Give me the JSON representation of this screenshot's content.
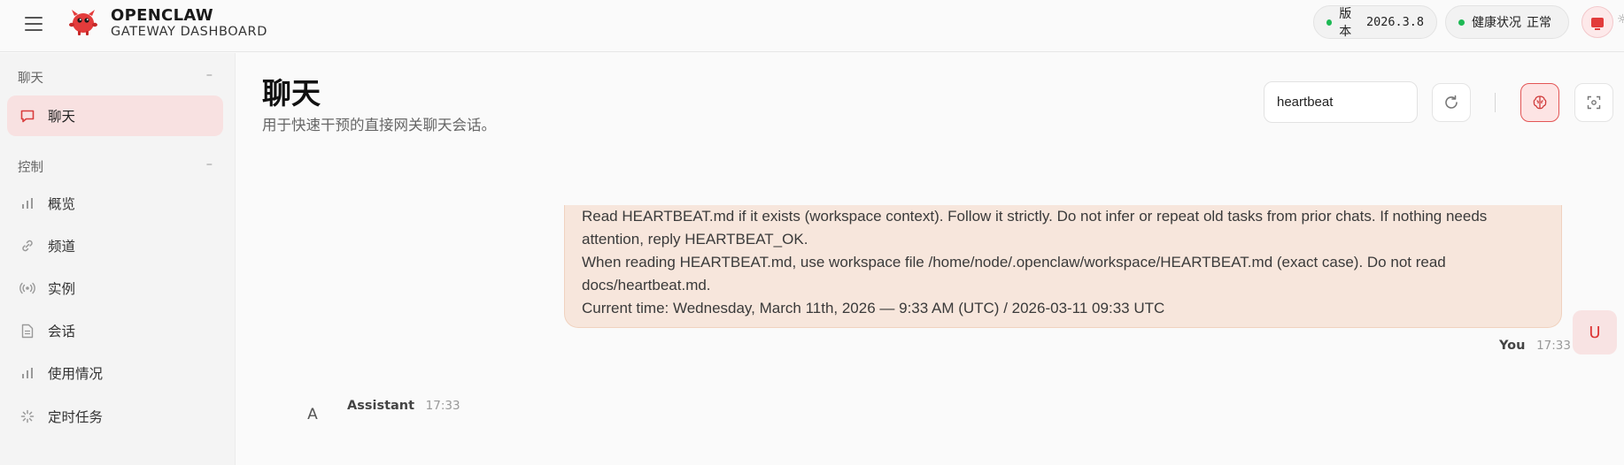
{
  "topbar": {
    "brand_title": "OPENCLAW",
    "brand_subtitle": "GATEWAY DASHBOARD",
    "version_label": "版本",
    "version_value": "2026.3.8",
    "health_label": "健康状况",
    "health_value": "正常",
    "status_color": "#1db954",
    "accent_color": "#e23b3b"
  },
  "sidebar": {
    "sections": [
      {
        "title": "聊天",
        "collapse_symbol": "–",
        "items": [
          {
            "label": "聊天",
            "icon": "chat-bubble-icon",
            "active": true
          }
        ]
      },
      {
        "title": "控制",
        "collapse_symbol": "–",
        "items": [
          {
            "label": "概览",
            "icon": "bar-chart-icon"
          },
          {
            "label": "频道",
            "icon": "link-icon"
          },
          {
            "label": "实例",
            "icon": "broadcast-icon"
          },
          {
            "label": "会话",
            "icon": "document-icon"
          },
          {
            "label": "使用情况",
            "icon": "bar-chart-icon"
          },
          {
            "label": "定时任务",
            "icon": "spinner-icon"
          }
        ]
      }
    ]
  },
  "main": {
    "title": "聊天",
    "subtitle": "用于快速干预的直接网关聊天会话。",
    "session_input_value": "heartbeat",
    "messages": [
      {
        "role": "user",
        "sender": "You",
        "time": "17:33",
        "avatar": "U",
        "lines": [
          "Read HEARTBEAT.md if it exists (workspace context). Follow it strictly. Do not infer or repeat old tasks from prior chats. If nothing needs",
          "attention, reply HEARTBEAT_OK.",
          "When reading HEARTBEAT.md, use workspace file /home/node/.openclaw/workspace/HEARTBEAT.md (exact case). Do not read",
          "docs/heartbeat.md.",
          "Current time: Wednesday, March 11th, 2026 — 9:33 AM (UTC) / 2026-03-11 09:33 UTC"
        ]
      },
      {
        "role": "assistant",
        "sender": "Assistant",
        "time": "17:33",
        "avatar": "A"
      }
    ]
  }
}
